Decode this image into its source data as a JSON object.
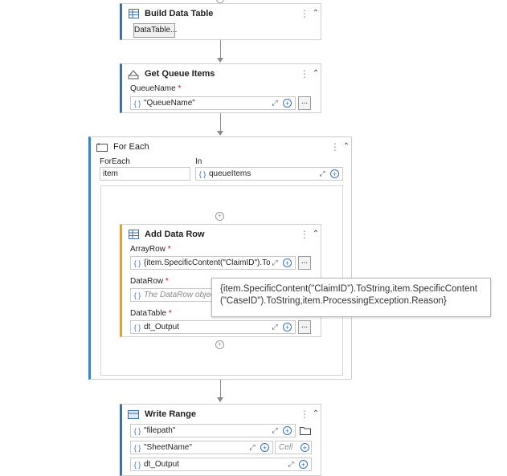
{
  "build_data_table": {
    "title": "Build Data Table",
    "button_label": "DataTable..."
  },
  "get_queue_items": {
    "title": "Get Queue Items",
    "queue_name_label": "QueueName",
    "queue_name_value": "\"QueueName\"",
    "dots": "..."
  },
  "for_each": {
    "title": "For Each",
    "foreach_label": "ForEach",
    "foreach_value": "item",
    "in_label": "In",
    "in_value": "queueItems"
  },
  "add_data_row": {
    "title": "Add Data Row",
    "array_row_label": "ArrayRow",
    "array_row_value": "{item.SpecificContent(\"ClaimID\").ToStri",
    "data_row_label": "DataRow",
    "data_row_placeholder": "The DataRow object",
    "data_table_label": "DataTable",
    "data_table_value": "dt_Output",
    "dots": "..."
  },
  "tooltip": {
    "line1": "{item.SpecificContent(\"ClaimID\").ToString,item.SpecificContent",
    "line2": "(\"CaseID\").ToString,item.ProcessingException.Reason}"
  },
  "write_range": {
    "title": "Write Range",
    "file_value": "\"filepath\"",
    "sheet_value": "\"SheetName\"",
    "cell_placeholder": "Cell",
    "data_value": "dt_Output"
  },
  "common": {
    "required_mark": "*",
    "curly": "{ }",
    "plus": "+",
    "expand": "⤢",
    "collapse": "⌃⌃"
  }
}
